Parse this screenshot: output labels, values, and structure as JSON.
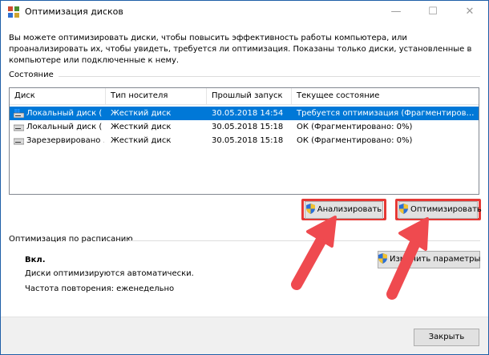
{
  "window": {
    "title": "Оптимизация дисков",
    "minimize_icon": "minimize-icon",
    "maximize_icon": "maximize-icon",
    "close_icon": "close-icon"
  },
  "intro_text": "Вы можете оптимизировать диски, чтобы повысить эффективность работы  компьютера, или проанализировать их, чтобы увидеть, требуется ли оптимизация. Показаны только диски, установленные в компьютере или подключенные к нему.",
  "status": {
    "heading": "Состояние",
    "columns": [
      "Диск",
      "Тип носителя",
      "Прошлый запуск",
      "Текущее состояние"
    ],
    "rows": [
      {
        "disk": "Локальный диск (",
        "media": "Жесткий диск",
        "last_run": "30.05.2018 14:54",
        "state": "Требуется оптимизация (Фрагментиров…",
        "icon": "windows-drive-icon",
        "selected": true
      },
      {
        "disk": "Локальный диск (",
        "media": "Жесткий диск",
        "last_run": "30.05.2018 15:18",
        "state": "ОК (Фрагментировано: 0%)",
        "icon": "hard-drive-icon",
        "selected": false
      },
      {
        "disk": "Зарезервировано …",
        "media": "Жесткий диск",
        "last_run": "30.05.2018 15:18",
        "state": "ОК (Фрагментировано: 0%)",
        "icon": "hard-drive-icon",
        "selected": false
      }
    ]
  },
  "buttons": {
    "analyze": "Анализировать",
    "optimize": "Оптимизировать",
    "change_settings": "Изменить параметры",
    "close": "Закрыть"
  },
  "schedule": {
    "heading": "Оптимизация по расписанию",
    "state": "Вкл.",
    "description": "Диски оптимизируются автоматически.",
    "frequency": "Частота повторения: еженедельно"
  },
  "colors": {
    "selection": "#0078d7",
    "highlight": "#e53935",
    "arrow": "#ef4a4f"
  }
}
